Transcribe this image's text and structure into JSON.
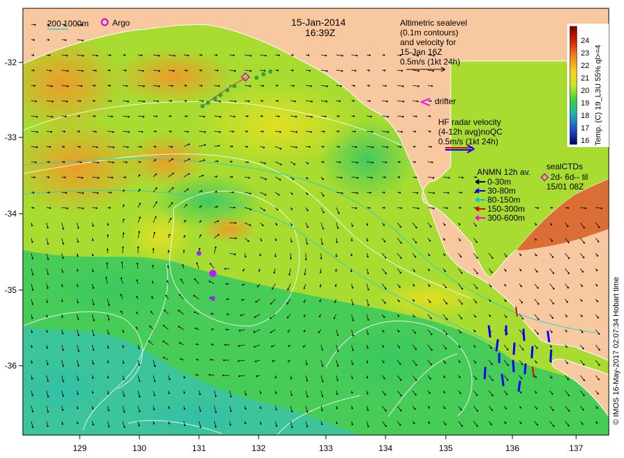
{
  "map": {
    "date": "15-Jan-2014",
    "time": "16:39Z",
    "lon_ticks": [
      "129",
      "130",
      "131",
      "132",
      "133",
      "134",
      "135",
      "136",
      "137"
    ],
    "lat_ticks": [
      "-32",
      "-33",
      "-34",
      "-35",
      "-36"
    ]
  },
  "legend_top_left": {
    "contours": "200 1000m",
    "argo": "Argo"
  },
  "altimetry": {
    "lines": [
      "Altimetric sealevel",
      "(0.1m contours)",
      "and velocity for",
      "15-Jan 16Z"
    ],
    "scale": "0.5m/s (1kt 24h)"
  },
  "drifter": {
    "label": "drifter"
  },
  "hf_radar": {
    "lines": [
      "HF radar velocity",
      "(4-12h avg)noQC"
    ],
    "scale": "0.5m/s (1kt 24h)"
  },
  "anmn": {
    "title": "ANMN 12h av.",
    "items": [
      {
        "label": "0-30m",
        "color": "#000000"
      },
      {
        "label": "30-80m",
        "color": "#0000ff"
      },
      {
        "label": "80-150m",
        "color": "#00c8c8"
      },
      {
        "label": "150-300m",
        "color": "#e00000"
      },
      {
        "label": "300-600m",
        "color": "#ff00ff"
      }
    ]
  },
  "sealctds": {
    "title": "sealCTDs",
    "line": "2d- 6d-- til",
    "date": "15/01 08Z"
  },
  "colorbar": {
    "ticks": [
      "24",
      "23",
      "22",
      "21",
      "20",
      "19",
      "18",
      "17",
      "16"
    ],
    "label": "Temp. (C) 19_L3U 55% ql>=4",
    "values": [
      24,
      16
    ]
  },
  "credit": "© IMOS 16-May-2017 02:07:34 Hobart time",
  "colors": {
    "land": "#f8c8a0",
    "warm": "#f0a030",
    "mid": "#d8e020",
    "cool": "#40d060",
    "cold": "#30c0a0",
    "argo": "#d000d0",
    "drifter": "#ff00ff"
  }
}
